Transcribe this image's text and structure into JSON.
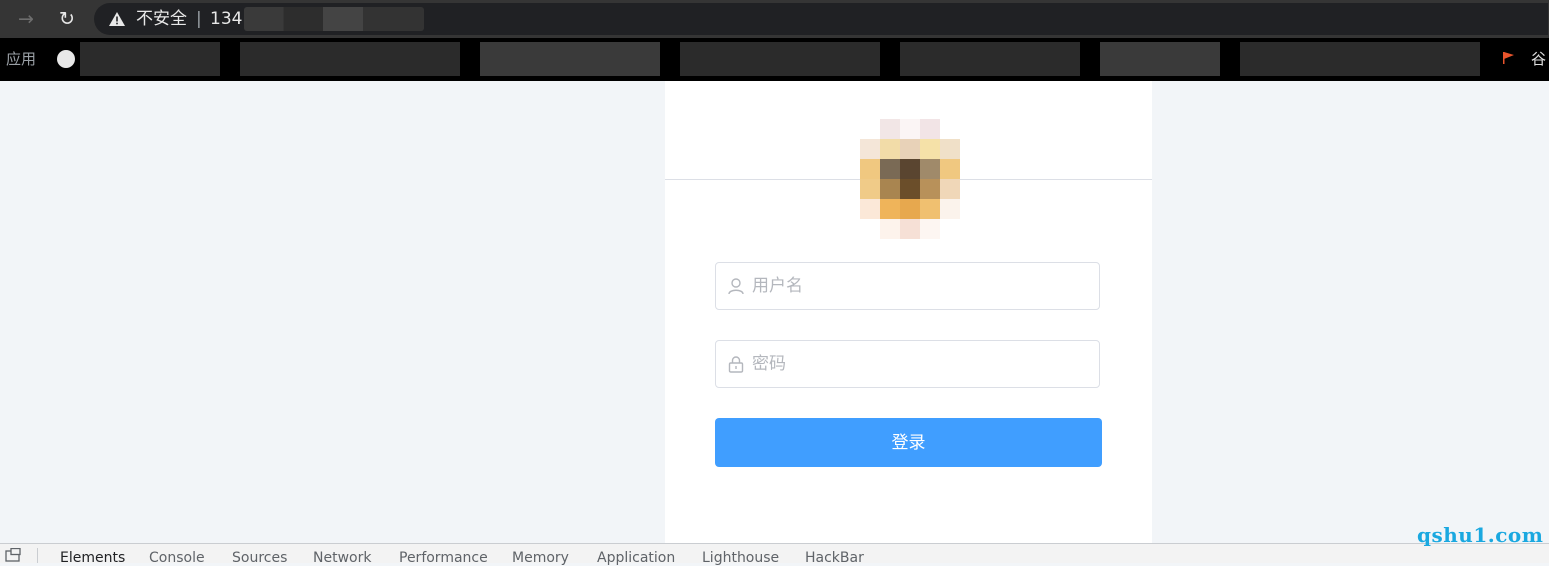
{
  "browser": {
    "security_label": "不安全",
    "separator": "|",
    "url": "134.",
    "bookmarks_apps": "应用",
    "bookmarks_last": "谷"
  },
  "login": {
    "username_placeholder": "用户名",
    "password_placeholder": "密码",
    "submit_label": "登录"
  },
  "devtools": {
    "tabs": [
      "Elements",
      "Console",
      "Sources",
      "Network",
      "Performance",
      "Memory",
      "Application",
      "Lighthouse",
      "HackBar"
    ]
  },
  "watermark": "qshu1.com",
  "colors": {
    "primary": "#409eff",
    "page_background": "#f2f5f8",
    "card_background": "#ffffff"
  }
}
